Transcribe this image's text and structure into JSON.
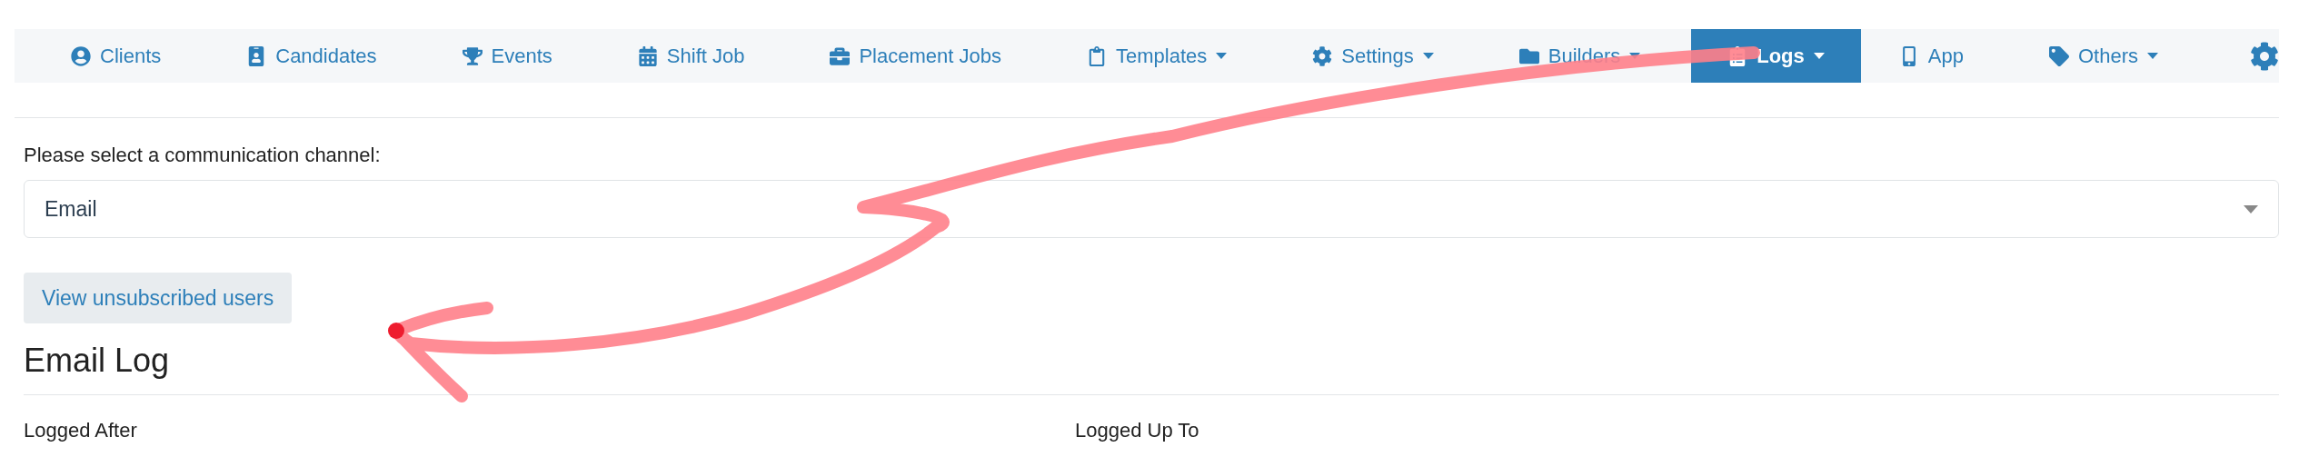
{
  "navbar": {
    "items": [
      {
        "label": "Clients",
        "selected": false,
        "has_menu": false
      },
      {
        "label": "Candidates",
        "selected": false,
        "has_menu": false
      },
      {
        "label": "Events",
        "selected": false,
        "has_menu": false
      },
      {
        "label": "Shift Job",
        "selected": false,
        "has_menu": false
      },
      {
        "label": "Placement Jobs",
        "selected": false,
        "has_menu": false
      },
      {
        "label": "Templates",
        "selected": false,
        "has_menu": true
      },
      {
        "label": "Settings",
        "selected": false,
        "has_menu": true
      },
      {
        "label": "Builders",
        "selected": false,
        "has_menu": true
      },
      {
        "label": "Logs",
        "selected": true,
        "has_menu": true
      },
      {
        "label": "App",
        "selected": false,
        "has_menu": false
      },
      {
        "label": "Others",
        "selected": false,
        "has_menu": true
      }
    ]
  },
  "channel": {
    "label": "Please select a communication channel:",
    "value": "Email"
  },
  "unsubscribed_button": "View unsubscribed users",
  "log": {
    "title": "Email Log",
    "filters": [
      "Logged After",
      "Logged Up To"
    ]
  }
}
